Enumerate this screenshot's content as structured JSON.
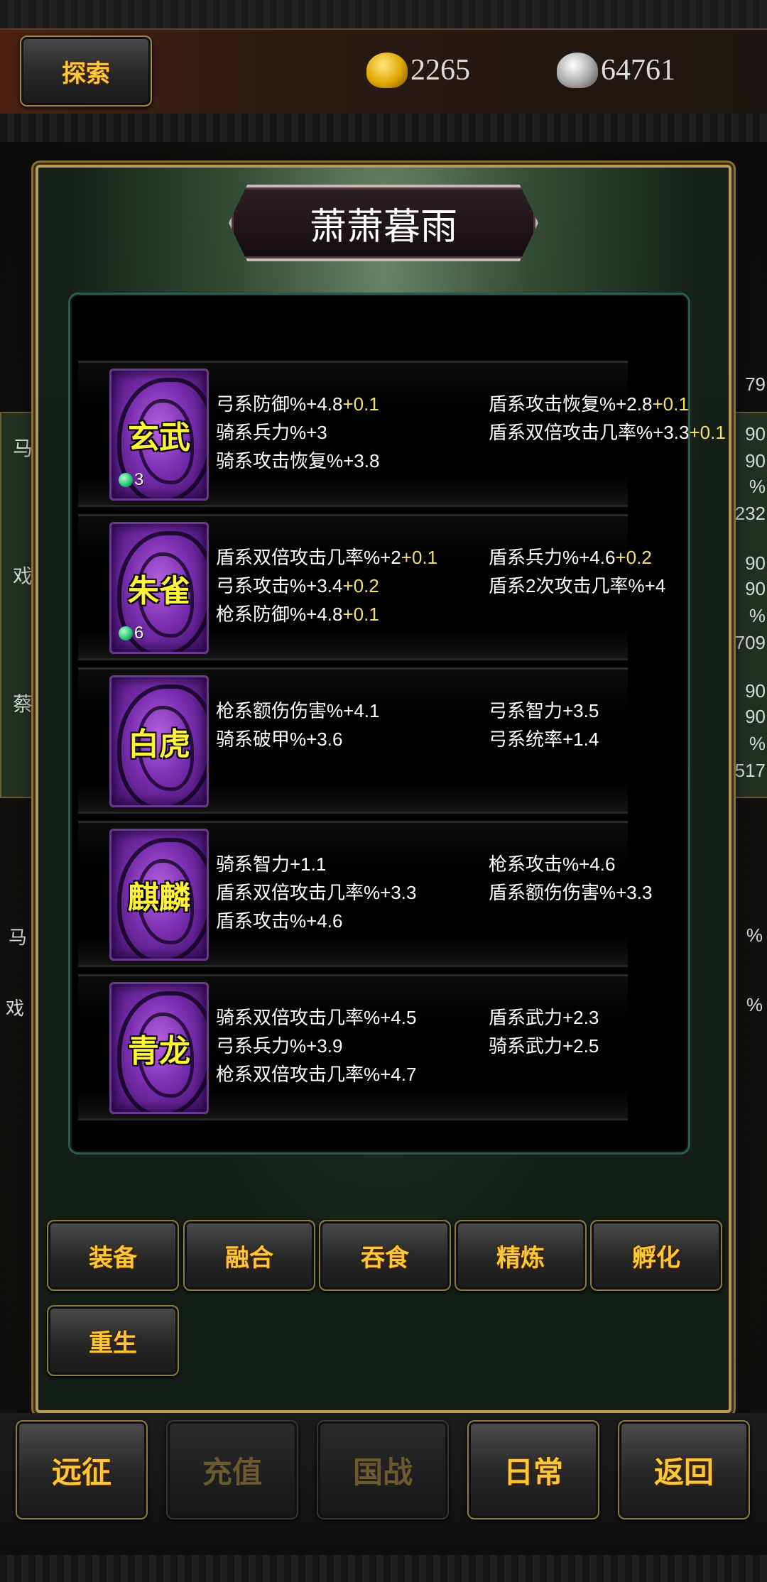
{
  "top": {
    "explore_label": "探索",
    "gold": "2265",
    "silver": "64761"
  },
  "background": {
    "left": [
      "马",
      "戏",
      "蔡",
      "马",
      "戏"
    ],
    "right": [
      "79",
      "90",
      "90",
      "%",
      "232",
      "90",
      "90",
      "%",
      "709",
      "90",
      "90",
      "%",
      "517",
      "%",
      "%"
    ]
  },
  "modal": {
    "title": "萧萧暮雨",
    "items": [
      {
        "name": "玄武",
        "level": "3",
        "col1": [
          {
            "text": "弓系防御%+4.8",
            "bonus": "+0.1"
          },
          {
            "text": "骑系兵力%+3",
            "bonus": ""
          },
          {
            "text": "骑系攻击恢复%+3.8",
            "bonus": ""
          }
        ],
        "col2": [
          {
            "text": "盾系攻击恢复%+2.8",
            "bonus": "+0.1"
          },
          {
            "text": "盾系双倍攻击几率%+3.3",
            "bonus": "+0.1"
          }
        ]
      },
      {
        "name": "朱雀",
        "level": "6",
        "col1": [
          {
            "text": "盾系双倍攻击几率%+2",
            "bonus": "+0.1"
          },
          {
            "text": "弓系攻击%+3.4",
            "bonus": "+0.2"
          },
          {
            "text": "枪系防御%+4.8",
            "bonus": "+0.1"
          }
        ],
        "col2": [
          {
            "text": "盾系兵力%+4.6",
            "bonus": "+0.2"
          },
          {
            "text": "盾系2次攻击几率%+4",
            "bonus": ""
          }
        ]
      },
      {
        "name": "白虎",
        "level": "",
        "col1": [
          {
            "text": "枪系额伤伤害%+4.1",
            "bonus": ""
          },
          {
            "text": "骑系破甲%+3.6",
            "bonus": ""
          }
        ],
        "col2": [
          {
            "text": "弓系智力+3.5",
            "bonus": ""
          },
          {
            "text": "弓系统率+1.4",
            "bonus": ""
          }
        ]
      },
      {
        "name": "麒麟",
        "level": "",
        "col1": [
          {
            "text": "骑系智力+1.1",
            "bonus": ""
          },
          {
            "text": "盾系双倍攻击几率%+3.3",
            "bonus": ""
          },
          {
            "text": "盾系攻击%+4.6",
            "bonus": ""
          }
        ],
        "col2": [
          {
            "text": "枪系攻击%+4.6",
            "bonus": ""
          },
          {
            "text": "盾系额伤伤害%+3.3",
            "bonus": ""
          }
        ]
      },
      {
        "name": "青龙",
        "level": "",
        "col1": [
          {
            "text": "骑系双倍攻击几率%+4.5",
            "bonus": ""
          },
          {
            "text": "弓系兵力%+3.9",
            "bonus": ""
          },
          {
            "text": "枪系双倍攻击几率%+4.7",
            "bonus": ""
          }
        ],
        "col2": [
          {
            "text": "盾系武力+2.3",
            "bonus": ""
          },
          {
            "text": "骑系武力+2.5",
            "bonus": ""
          }
        ]
      }
    ],
    "actions": [
      "装备",
      "融合",
      "吞食",
      "精炼",
      "孵化",
      "重生"
    ]
  },
  "bottom_nav": [
    "远征",
    "充值",
    "国战",
    "日常",
    "返回"
  ],
  "colors": {
    "accent_gold": "#f7c83a",
    "bonus_yellow": "#f0e070",
    "tile_purple": "#7a2fb0"
  },
  "icons": {
    "gold": "gold-ingot-icon",
    "silver": "silver-ingot-icon",
    "level_gem": "gem-icon"
  }
}
